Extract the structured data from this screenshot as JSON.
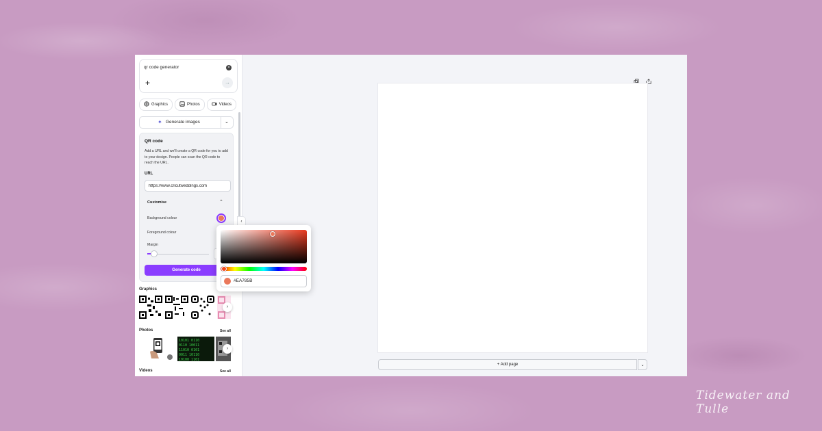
{
  "search": {
    "query": "qr code generator"
  },
  "chips": [
    {
      "label": "Graphics",
      "icon": "graphics-icon"
    },
    {
      "label": "Photos",
      "icon": "photos-icon"
    },
    {
      "label": "Videos",
      "icon": "videos-icon"
    }
  ],
  "generate_images": {
    "label": "Generate images"
  },
  "qr_code": {
    "title": "QR code",
    "description": "Add a URL and we'll create a QR code for you to add to your design. People can scan the QR code to reach the URL.",
    "url_label": "URL",
    "url_value": "https://www.cricutweddings.com",
    "customise_label": "Customise",
    "background_colour_label": "Background colour",
    "foreground_colour_label": "Foreground colour",
    "margin_label": "Margin",
    "generate_label": "Generate code"
  },
  "sections": {
    "graphics_label": "Graphics",
    "photos_label": "Photos",
    "photos_see_all": "See all",
    "videos_label": "Videos",
    "videos_see_all": "See all"
  },
  "color_picker": {
    "hex": "#EA785B",
    "selected_color": "#EA785B"
  },
  "canvas": {
    "add_page_label": "+ Add page"
  },
  "colors": {
    "accent": "#8b3dff",
    "background": "#c89bc2"
  },
  "watermark": {
    "text": "Tidewater and Tulle"
  }
}
